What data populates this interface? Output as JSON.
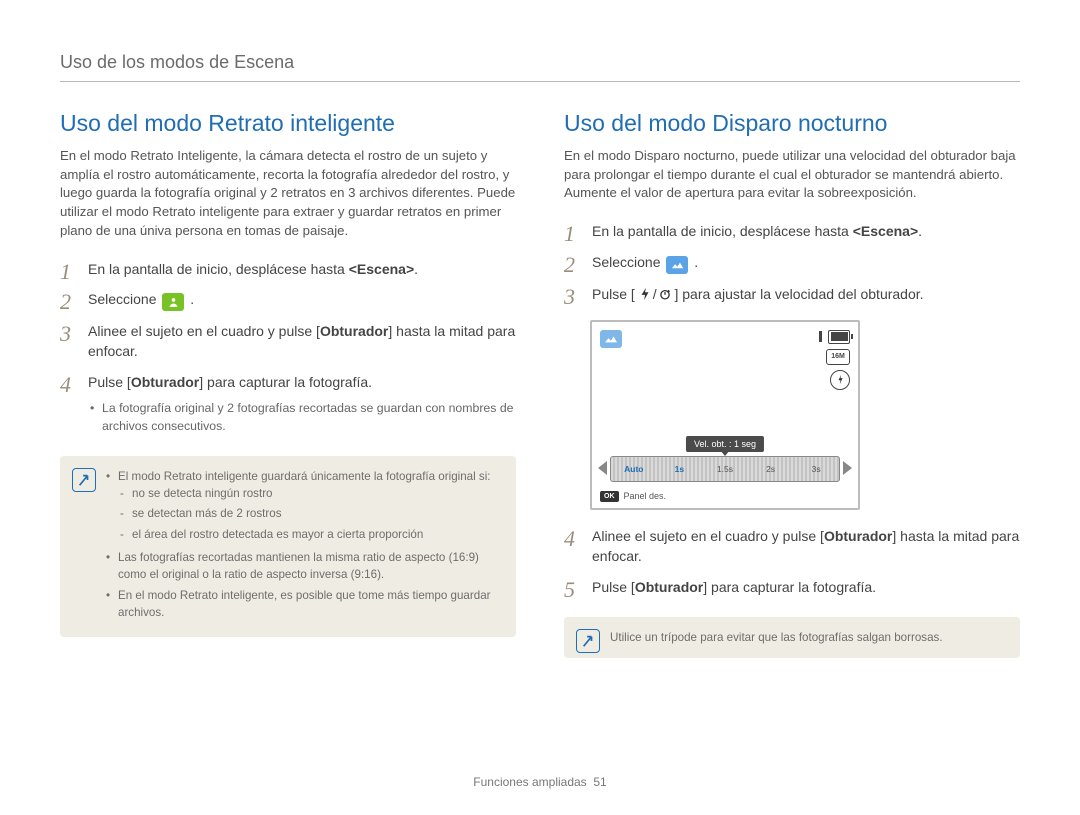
{
  "running_head": "Uso de los modos de Escena",
  "footer": {
    "section": "Funciones ampliadas",
    "page": "51"
  },
  "left": {
    "title": "Uso del modo Retrato inteligente",
    "intro": "En el modo Retrato Inteligente, la cámara detecta el rostro de un sujeto y amplía el rostro automáticamente, recorta la fotografía alrededor del rostro, y luego guarda la fotografía original y 2 retratos en 3 archivos diferentes. Puede utilizar el modo Retrato inteligente para extraer y guardar retratos en primer plano de una úniva persona en tomas de paisaje.",
    "steps": [
      {
        "n": "1",
        "pre": "En la pantalla de inicio, desplácese hasta ",
        "bold": "<Escena>",
        "post": "."
      },
      {
        "n": "2",
        "pre": "Seleccione ",
        "icon": "portrait",
        "post": "."
      },
      {
        "n": "3",
        "pre": "Alinee el sujeto en el cuadro y pulse [",
        "bold": "Obturador",
        "post": "] hasta la mitad para enfocar."
      },
      {
        "n": "4",
        "pre": "Pulse [",
        "bold": "Obturador",
        "post": "] para capturar la fotografía.",
        "sub": [
          "La fotografía original y 2 fotografías recortadas se guardan con nombres de archivos consecutivos."
        ]
      }
    ],
    "note": [
      {
        "t": "El modo Retrato inteligente guardará únicamente la fotografía original si:",
        "sub": [
          "no se detecta ningún rostro",
          "se detectan más de 2 rostros",
          "el área del rostro detectada es mayor a cierta proporción"
        ]
      },
      {
        "t": "Las fotografías recortadas mantienen la misma ratio de aspecto (16:9) como el original o la ratio de aspecto inversa (9:16)."
      },
      {
        "t": "En el modo Retrato inteligente, es posible que tome más tiempo guardar archivos."
      }
    ]
  },
  "right": {
    "title": "Uso del modo Disparo nocturno",
    "intro": "En el modo Disparo nocturno, puede utilizar una velocidad del obturador baja para prolongar el tiempo durante el cual el obturador se mantendrá abierto. Aumente el valor de apertura para evitar la sobreexposición.",
    "steps": [
      {
        "n": "1",
        "pre": "En la pantalla de inicio, desplácese hasta ",
        "bold": "<Escena>",
        "post": "."
      },
      {
        "n": "2",
        "pre": "Seleccione ",
        "icon": "night",
        "post": "."
      },
      {
        "n": "3",
        "pre": "Pulse [",
        "icons": "flash-timer",
        "post": "] para ajustar la velocidad del obturador."
      },
      {
        "n": "4",
        "pre": "Alinee el sujeto en el cuadro y pulse [",
        "bold": "Obturador",
        "post": "] hasta la mitad para enfocar."
      },
      {
        "n": "5",
        "pre": "Pulse [",
        "bold": "Obturador",
        "post": "] para capturar la fotografía."
      }
    ],
    "lcd": {
      "label": "Vel. obt. : 1 seg",
      "marks": [
        "Auto",
        "1s",
        "1.5s",
        "2s",
        "3s"
      ],
      "active": 1,
      "res": "16M",
      "flash": "⊕",
      "foot_btn": "OK",
      "foot_label": "Panel des."
    },
    "note_simple": "Utilice un trípode para evitar que las fotografías salgan borrosas."
  }
}
